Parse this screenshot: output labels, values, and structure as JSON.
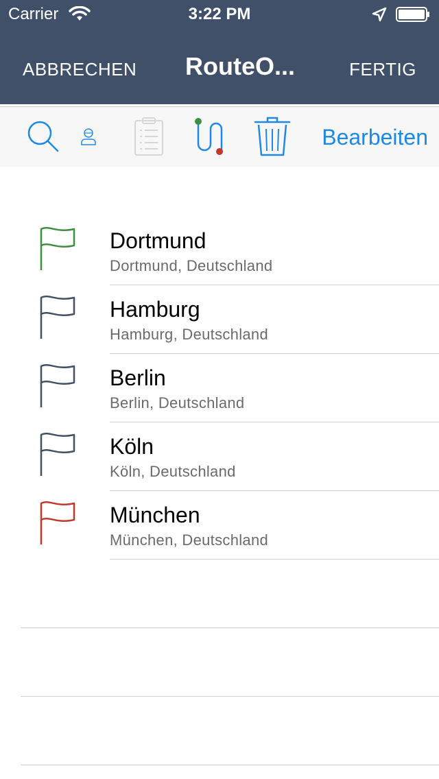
{
  "status_bar": {
    "carrier": "Carrier",
    "time": "3:22 PM"
  },
  "nav": {
    "left_label": "ABBRECHEN",
    "title": "RouteO...",
    "right_label": "FERTIG"
  },
  "toolbar": {
    "edit_label": "Bearbeiten",
    "accent_color": "#1e88e5"
  },
  "stops": [
    {
      "name": "Dortmund",
      "address": "Dortmund, Deutschland",
      "flag_color": "#3e8e41"
    },
    {
      "name": "Hamburg",
      "address": "Hamburg, Deutschland",
      "flag_color": "#405069"
    },
    {
      "name": "Berlin",
      "address": "Berlin, Deutschland",
      "flag_color": "#405069"
    },
    {
      "name": "Köln",
      "address": "Köln, Deutschland",
      "flag_color": "#405069"
    },
    {
      "name": "München",
      "address": "München, Deutschland",
      "flag_color": "#c0392b"
    }
  ]
}
